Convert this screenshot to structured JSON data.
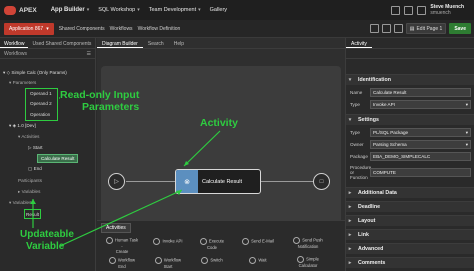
{
  "topbar": {
    "brand": "APEX",
    "app_builder": "App Builder",
    "sql_workshop": "SQL Workshop",
    "team_development": "Team Development",
    "gallery": "Gallery",
    "user_name": "Steve Muench",
    "user_sub": "smuench"
  },
  "crumbs": {
    "active": "Application 867",
    "items": [
      "Shared Components",
      "Workflows",
      "Workflow Definition"
    ],
    "edit_page": "Edit Page 1",
    "save": "Save"
  },
  "left": {
    "tabs": [
      "Workflow",
      "Used Shared Components"
    ],
    "sub": "Workflows",
    "tree": {
      "root": "Simple Calc (Only Params)",
      "parameters": "Parameters",
      "operand1": "Operand 1",
      "operand2": "Operand 2",
      "operation": "Operation",
      "version": "1.0 [Dev]",
      "activities": "Activities",
      "start": "Start",
      "calc": "Calculate Result",
      "end": "End",
      "participants": "Participants",
      "variables1": "Variables",
      "variables2": "Variables",
      "result": "Result"
    }
  },
  "center": {
    "tabs": [
      "Diagram Builder",
      "Search",
      "Help"
    ],
    "activity_label": "Calculate Result",
    "palette_tab": "Activities",
    "palette": [
      [
        "Human Task -",
        "Create"
      ],
      [
        "Invoke API",
        ""
      ],
      [
        "Execute Code",
        ""
      ],
      [
        "Send E-Mail",
        ""
      ],
      [
        "Send Push",
        "Notification"
      ],
      [
        "Workflow End",
        ""
      ],
      [
        "Workflow Start",
        ""
      ],
      [
        "Switch",
        ""
      ],
      [
        "Wait",
        ""
      ],
      [
        "Simple",
        "Calculator"
      ]
    ]
  },
  "right": {
    "tab": "Activity",
    "sections": {
      "identification": "Identification",
      "settings": "Settings",
      "additional": "Additional Data",
      "deadline": "Deadline",
      "layout": "Layout",
      "link": "Link",
      "advanced": "Advanced",
      "comments": "Comments"
    },
    "props": {
      "name_label": "Name",
      "name_value": "Calculate Result",
      "type_label": "Type",
      "type_value": "Invoke API",
      "stype_label": "Type",
      "stype_value": "PL/SQL Package",
      "owner_label": "Owner",
      "owner_value": "Parsing Schema",
      "pkg_label": "Package",
      "pkg_value": "EBA_DEMO_SIMPLECALC",
      "proc_label": "Procedure or Function",
      "proc_value": "COMPUTE"
    }
  },
  "annotations": {
    "readonly_line1": "Read-only Input",
    "readonly_line2": "Parameters",
    "activity": "Activity",
    "updateable_line1": "Updateable",
    "updateable_line2": "Variable"
  }
}
